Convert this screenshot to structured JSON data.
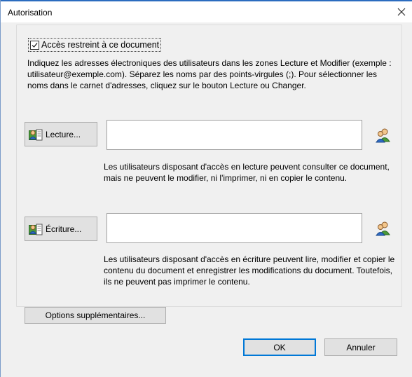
{
  "window": {
    "title": "Autorisation"
  },
  "restriction": {
    "checked": true,
    "label": "Accès restreint à ce document"
  },
  "instructions": "Indiquez les adresses électroniques des utilisateurs dans les zones Lecture et Modifier (exemple : utilisateur@exemple.com). Séparez les noms par des points-virgules (;). Pour sélectionner les noms dans le carnet d'adresses, cliquez sur le bouton Lecture ou Changer.",
  "read": {
    "button_label": "Lecture...",
    "value": "",
    "description": "Les utilisateurs disposant d'accès en lecture peuvent consulter ce document, mais ne peuvent le modifier, ni l'imprimer, ni en copier le contenu."
  },
  "write": {
    "button_label": "Écriture...",
    "value": "",
    "description": "Les utilisateurs disposant d'accès en écriture peuvent lire, modifier et copier le contenu du document et enregistrer les modifications du document. Toutefois, ils ne peuvent pas imprimer le contenu."
  },
  "more_options_label": "Options supplémentaires...",
  "ok_label": "OK",
  "cancel_label": "Annuler",
  "icons": {
    "close": "close-icon",
    "user_book": "user-address-book-icon",
    "check_names": "check-names-icon"
  }
}
